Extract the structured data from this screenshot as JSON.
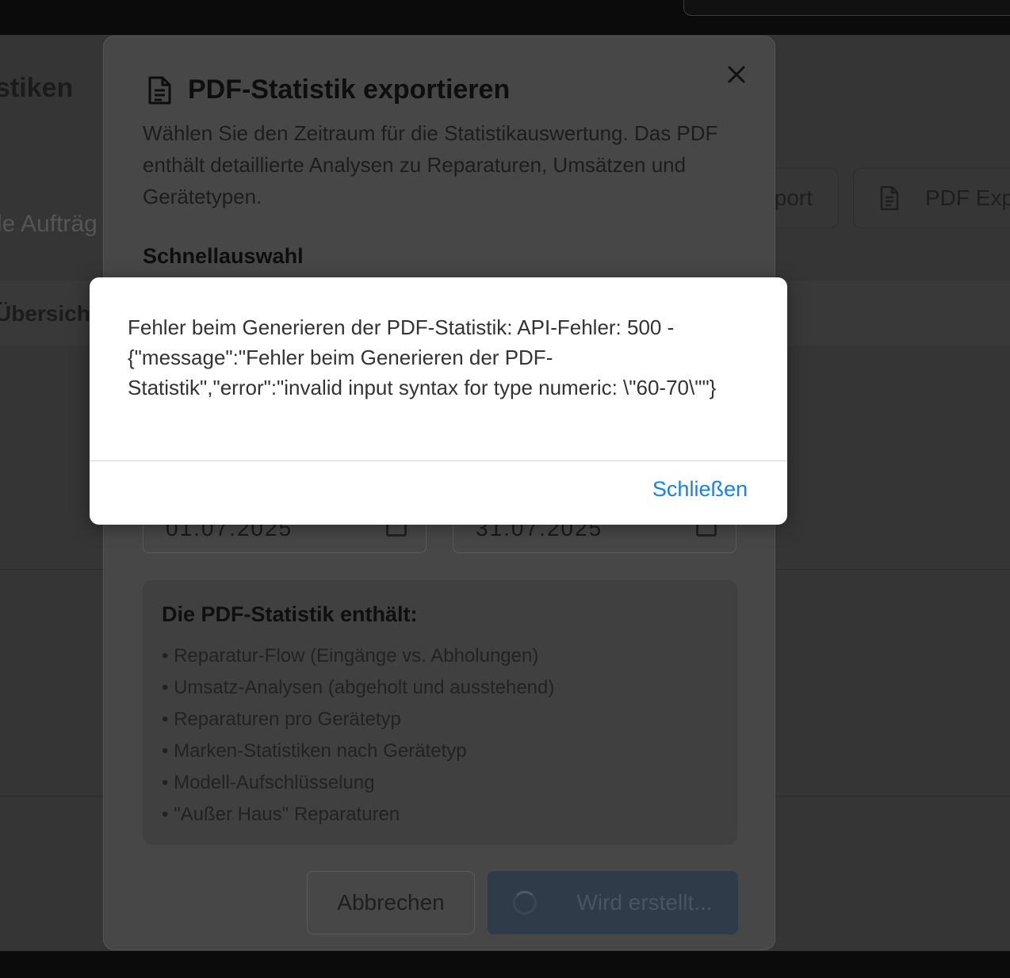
{
  "background": {
    "page_title_fragment": "stiken",
    "subtitle_fragment": "le Aufträg",
    "buttons": {
      "export_fragment": "port",
      "pdf_export_fragment": "PDF Exp"
    },
    "tab_fragment": "Übersicht"
  },
  "dialog": {
    "title": "PDF-Statistik exportieren",
    "description": "Wählen Sie den Zeitraum für die Statistikauswertung. Das PDF enthält detaillierte Analysen zu Reparaturen, Umsätzen und Gerätetypen.",
    "quick_select_label": "Schnellauswahl",
    "start_date": "01.07.2025",
    "end_date": "31.07.2025",
    "info_heading": "Die PDF-Statistik enthält:",
    "info_items": [
      "Reparatur-Flow (Eingänge vs. Abholungen)",
      "Umsatz-Analysen (abgeholt und ausstehend)",
      "Reparaturen pro Gerätetyp",
      "Marken-Statistiken nach Gerätetyp",
      "Modell-Aufschlüsselung",
      "\"Außer Haus\" Reparaturen"
    ],
    "cancel_label": "Abbrechen",
    "submit_label": "Wird erstellt..."
  },
  "alert": {
    "message": "Fehler beim Generieren der PDF-Statistik: API-Fehler: 500 - {\"message\":\"Fehler beim Generieren der PDF-Statistik\",\"error\":\"invalid input syntax for type numeric: \\\"60-70\\\"\"}",
    "close_label": "Schließen"
  },
  "colors": {
    "accent": "#1b7ff0",
    "overlay": "#353535"
  }
}
